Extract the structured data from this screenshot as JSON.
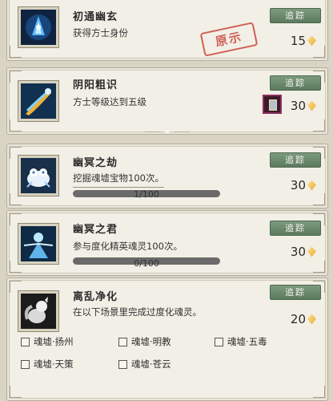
{
  "quests": [
    {
      "title": "初通幽玄",
      "desc": "获得方士身份",
      "track_label": "追踪",
      "reward": "15",
      "stamp": "原示",
      "icon": "blue-crystal-icon"
    },
    {
      "title": "阴阳粗识",
      "desc": "方士等级达到五级",
      "track_label": "追踪",
      "reward": "30",
      "icon": "blue-comet-icon",
      "reward_item_icon": "scroll-box-icon"
    },
    {
      "title": "幽冥之劫",
      "desc": "挖掘魂墟宝物100次。",
      "track_label": "追踪",
      "reward": "30",
      "progress_text": "1/100",
      "progress": 0.01,
      "icon": "white-beast-icon"
    },
    {
      "title": "幽冥之君",
      "desc": "参与度化精英魂灵100次。",
      "track_label": "追踪",
      "reward": "30",
      "progress_text": "0/100",
      "progress": 0.0,
      "icon": "spirit-master-icon"
    },
    {
      "title": "离乱净化",
      "desc": "在以下场景里完成过度化魂灵。",
      "track_label": "追踪",
      "reward": "20",
      "icon": "white-fox-icon",
      "scenes": [
        "魂墟·扬州",
        "魂墟·明教",
        "魂墟·五毒",
        "魂墟·天策",
        "魂墟·苍云"
      ]
    }
  ],
  "colors": {
    "track_button": "#6b8a6d",
    "stamp": "#c9483e",
    "progress_bar": "#6a6a6a"
  }
}
